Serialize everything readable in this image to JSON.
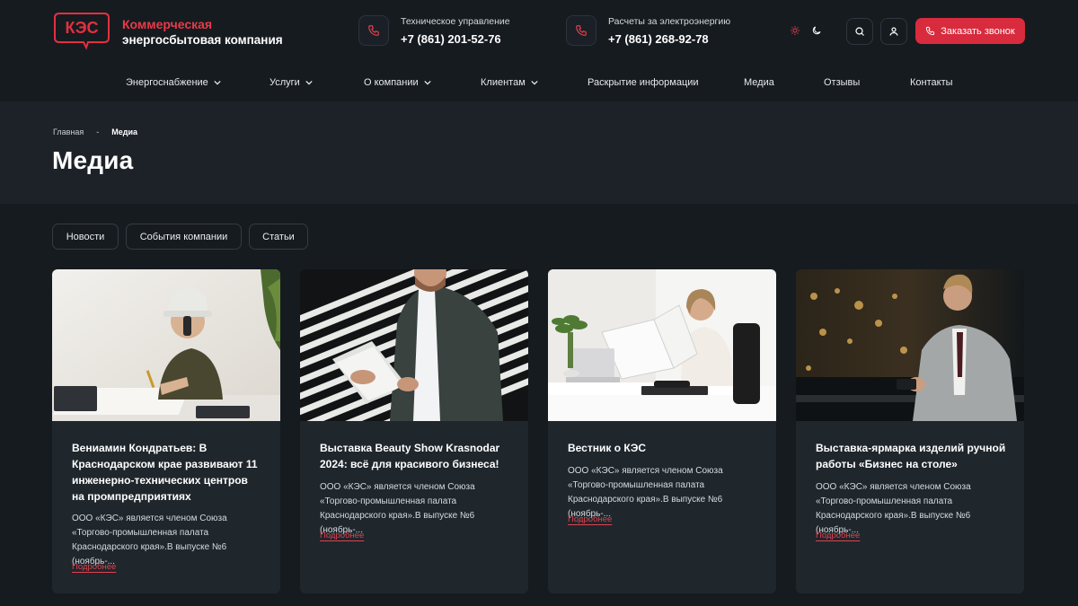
{
  "brand": {
    "logo_text": "КЭС",
    "name_line1": "Коммерческая",
    "name_line2": "энергосбытовая компания"
  },
  "contacts": [
    {
      "label": "Техническое управление",
      "phone": "+7 (861) 201-52-76",
      "icon": "phone-icon"
    },
    {
      "label": "Расчеты за электроэнергию",
      "phone": "+7 (861) 268-92-78",
      "icon": "phone-icon"
    }
  ],
  "header_actions": {
    "theme_light_icon": "sun-icon",
    "theme_dark_icon": "moon-icon",
    "search_icon": "search-icon",
    "account_icon": "user-icon",
    "cta_label": "Заказать звонок"
  },
  "nav": [
    {
      "label": "Энергоснабжение",
      "has_dropdown": true
    },
    {
      "label": "Услуги",
      "has_dropdown": true
    },
    {
      "label": "О компании",
      "has_dropdown": true
    },
    {
      "label": "Клиентам",
      "has_dropdown": true
    },
    {
      "label": "Раскрытие информации",
      "has_dropdown": false
    },
    {
      "label": "Медиа",
      "has_dropdown": false
    },
    {
      "label": "Отзывы",
      "has_dropdown": false
    },
    {
      "label": "Контакты",
      "has_dropdown": false
    }
  ],
  "breadcrumb": {
    "home": "Главная",
    "separator": "-",
    "current": "Медиа"
  },
  "page_title": "Медиа",
  "filters": [
    "Новости",
    "События компании",
    "Статьи"
  ],
  "cards": [
    {
      "title": "Вениамин Кондратьев: В Краснодарском крае развивают 11 инженерно-технических центров на промпредприятиях",
      "description": "ООО «КЭС» является членом Союза «Торгово-промышленная палата Краснодарского края».В выпуске №6 (ноябрь-...",
      "more": "Подробнее"
    },
    {
      "title": "Выставка Beauty Show Krasnodar 2024: всё для красивого бизнеса!",
      "description": "ООО «КЭС» является членом Союза «Торгово-промышленная палата Краснодарского края».В выпуске №6 (ноябрь-...",
      "more": "Подробнее"
    },
    {
      "title": "Вестник о КЭС",
      "description": "ООО «КЭС» является членом Союза «Торгово-промышленная палата Краснодарского края».В выпуске №6 (ноябрь-...",
      "more": "Подробнее"
    },
    {
      "title": "Выставка-ярмарка изделий ручной работы «Бизнес на столе»",
      "description": "ООО «КЭС» является членом Союза «Торгово-промышленная палата Краснодарского края».В выпуске №6 (ноябрь-...",
      "more": "Подробнее"
    }
  ],
  "colors": {
    "accent": "#e0424f",
    "cta": "#d82b3d",
    "background": "#161b20",
    "hero": "#1c2227",
    "card": "#1f262c"
  }
}
